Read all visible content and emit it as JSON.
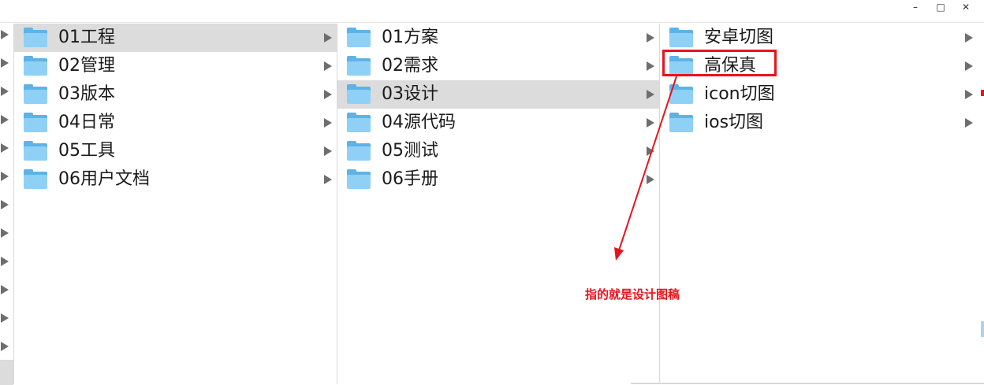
{
  "window": {
    "minimize_icon": "minimize-icon",
    "maximize_icon": "maximize-icon",
    "close_icon": "close-icon"
  },
  "columns": [
    {
      "items": [
        {
          "label": "01工程",
          "selected": true
        },
        {
          "label": "02管理",
          "selected": false
        },
        {
          "label": "03版本",
          "selected": false
        },
        {
          "label": "04日常",
          "selected": false
        },
        {
          "label": "05工具",
          "selected": false
        },
        {
          "label": "06用户文档",
          "selected": false
        }
      ]
    },
    {
      "items": [
        {
          "label": "01方案",
          "selected": false
        },
        {
          "label": "02需求",
          "selected": false
        },
        {
          "label": "03设计",
          "selected": true
        },
        {
          "label": "04源代码",
          "selected": false
        },
        {
          "label": "05测试",
          "selected": false
        },
        {
          "label": "06手册",
          "selected": false
        }
      ]
    },
    {
      "items": [
        {
          "label": "安卓切图",
          "selected": false
        },
        {
          "label": "高保真",
          "selected": false,
          "highlighted": true
        },
        {
          "label": "icon切图",
          "selected": false
        },
        {
          "label": "ios切图",
          "selected": false
        }
      ]
    }
  ],
  "annotation": {
    "text": "指的就是设计图稿",
    "color": "#e8141c"
  },
  "colors": {
    "selection": "#dcdcdc",
    "folder": "#8fd0f6",
    "accent_red": "#e8141c"
  }
}
